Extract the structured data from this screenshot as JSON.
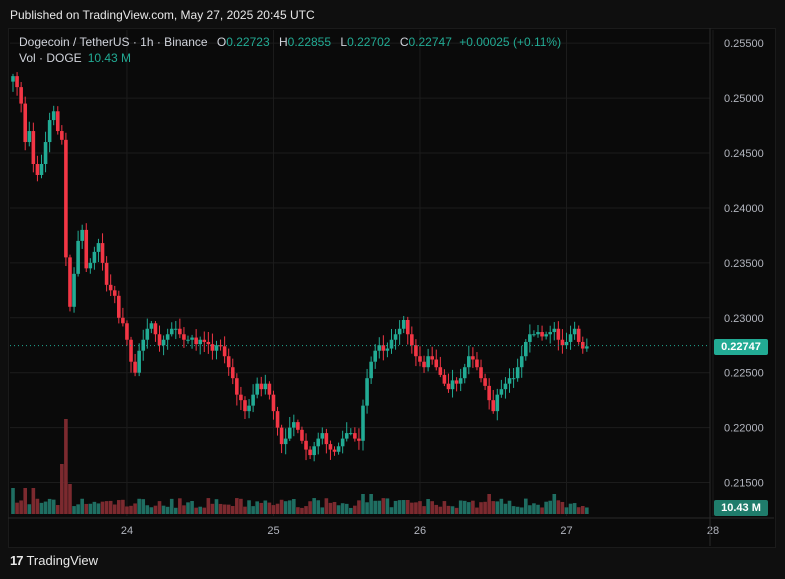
{
  "header": {
    "published": "Published on TradingView.com, May 27, 2025 20:45 UTC"
  },
  "legend": {
    "symbol": "Dogecoin / TetherUS · 1h · Binance",
    "open_label": "O",
    "open": "0.22723",
    "high_label": "H",
    "high": "0.22855",
    "low_label": "L",
    "low": "0.22702",
    "close_label": "C",
    "close": "0.22747",
    "change": "+0.00025 (+0.11%)",
    "vol_label": "Vol · DOGE",
    "vol_value": "10.43 M"
  },
  "price_tag": "0.22747",
  "volume_tag": "10.43 M",
  "footer": {
    "brand": "TradingView",
    "logo_icon": "tradingview-logo-icon"
  },
  "colors": {
    "up": "#22ab94",
    "down": "#f23645",
    "up_volume": "#1f6e62",
    "down_volume": "#7c2a2f",
    "background": "#0a0a0a",
    "grid": "#1c1c1c"
  },
  "chart_data": {
    "type": "candlestick",
    "symbol": "DOGEUSDT",
    "interval": "1h",
    "ylim": [
      0.2125,
      0.2562
    ],
    "y_ticks": [
      "0.25500",
      "0.25000",
      "0.24500",
      "0.24000",
      "0.23500",
      "0.23000",
      "0.22500",
      "0.22000",
      "0.21500"
    ],
    "x_ticks": [
      {
        "label": "24",
        "index": 28
      },
      {
        "label": "25",
        "index": 64
      },
      {
        "label": "26",
        "index": 100
      },
      {
        "label": "27",
        "index": 136
      },
      {
        "label": "28",
        "index": 172
      }
    ],
    "last_price": 0.22747,
    "waypoints_close": [
      [
        0,
        0.252
      ],
      [
        1,
        0.251
      ],
      [
        2,
        0.2495
      ],
      [
        3,
        0.246
      ],
      [
        4,
        0.247
      ],
      [
        5,
        0.244
      ],
      [
        6,
        0.243
      ],
      [
        7,
        0.244
      ],
      [
        8,
        0.246
      ],
      [
        9,
        0.248
      ],
      [
        10,
        0.2488
      ],
      [
        11,
        0.247
      ],
      [
        12,
        0.2462
      ],
      [
        13,
        0.2355
      ],
      [
        14,
        0.231
      ],
      [
        15,
        0.234
      ],
      [
        16,
        0.237
      ],
      [
        17,
        0.238
      ],
      [
        18,
        0.2345
      ],
      [
        19,
        0.235
      ],
      [
        20,
        0.236
      ],
      [
        21,
        0.2368
      ],
      [
        22,
        0.235
      ],
      [
        23,
        0.233
      ],
      [
        24,
        0.2325
      ],
      [
        25,
        0.232
      ],
      [
        26,
        0.23
      ],
      [
        27,
        0.2295
      ],
      [
        28,
        0.228
      ],
      [
        29,
        0.226
      ],
      [
        30,
        0.225
      ],
      [
        31,
        0.227
      ],
      [
        32,
        0.228
      ],
      [
        33,
        0.229
      ],
      [
        34,
        0.2295
      ],
      [
        35,
        0.2285
      ],
      [
        36,
        0.2275
      ],
      [
        37,
        0.228
      ],
      [
        38,
        0.2285
      ],
      [
        39,
        0.229
      ],
      [
        40,
        0.229
      ],
      [
        41,
        0.2285
      ],
      [
        42,
        0.228
      ],
      [
        43,
        0.228
      ],
      [
        44,
        0.2282
      ],
      [
        45,
        0.2276
      ],
      [
        46,
        0.228
      ],
      [
        47,
        0.2278
      ],
      [
        48,
        0.2276
      ],
      [
        49,
        0.227
      ],
      [
        50,
        0.2275
      ],
      [
        51,
        0.2274
      ],
      [
        52,
        0.2265
      ],
      [
        53,
        0.2255
      ],
      [
        54,
        0.2245
      ],
      [
        55,
        0.223
      ],
      [
        56,
        0.2225
      ],
      [
        57,
        0.2215
      ],
      [
        58,
        0.222
      ],
      [
        59,
        0.223
      ],
      [
        60,
        0.224
      ],
      [
        61,
        0.2235
      ],
      [
        62,
        0.224
      ],
      [
        63,
        0.223
      ],
      [
        64,
        0.2215
      ],
      [
        65,
        0.22
      ],
      [
        66,
        0.2185
      ],
      [
        67,
        0.219
      ],
      [
        68,
        0.22
      ],
      [
        69,
        0.2205
      ],
      [
        70,
        0.2198
      ],
      [
        71,
        0.2188
      ],
      [
        72,
        0.218
      ],
      [
        73,
        0.2175
      ],
      [
        74,
        0.2183
      ],
      [
        75,
        0.219
      ],
      [
        76,
        0.2195
      ],
      [
        77,
        0.2185
      ],
      [
        78,
        0.218
      ],
      [
        79,
        0.2178
      ],
      [
        80,
        0.2183
      ],
      [
        81,
        0.219
      ],
      [
        82,
        0.2195
      ],
      [
        83,
        0.2195
      ],
      [
        84,
        0.219
      ],
      [
        85,
        0.2188
      ],
      [
        86,
        0.222
      ],
      [
        87,
        0.2245
      ],
      [
        88,
        0.226
      ],
      [
        89,
        0.227
      ],
      [
        90,
        0.2275
      ],
      [
        91,
        0.227
      ],
      [
        92,
        0.2272
      ],
      [
        93,
        0.228
      ],
      [
        94,
        0.2285
      ],
      [
        95,
        0.229
      ],
      [
        96,
        0.2298
      ],
      [
        97,
        0.2285
      ],
      [
        98,
        0.2275
      ],
      [
        99,
        0.2265
      ],
      [
        100,
        0.226
      ],
      [
        101,
        0.2255
      ],
      [
        102,
        0.2265
      ],
      [
        103,
        0.2262
      ],
      [
        104,
        0.2255
      ],
      [
        105,
        0.2248
      ],
      [
        106,
        0.224
      ],
      [
        107,
        0.2235
      ],
      [
        108,
        0.2243
      ],
      [
        109,
        0.224
      ],
      [
        110,
        0.2245
      ],
      [
        111,
        0.2255
      ],
      [
        112,
        0.2265
      ],
      [
        113,
        0.2262
      ],
      [
        114,
        0.2255
      ],
      [
        115,
        0.2245
      ],
      [
        116,
        0.2238
      ],
      [
        117,
        0.2225
      ],
      [
        118,
        0.2215
      ],
      [
        119,
        0.223
      ],
      [
        120,
        0.2235
      ],
      [
        121,
        0.224
      ],
      [
        122,
        0.2245
      ],
      [
        123,
        0.2245
      ],
      [
        124,
        0.2255
      ],
      [
        125,
        0.2265
      ],
      [
        126,
        0.2278
      ],
      [
        127,
        0.2285
      ],
      [
        128,
        0.2285
      ],
      [
        129,
        0.2287
      ],
      [
        130,
        0.2283
      ],
      [
        131,
        0.2285
      ],
      [
        132,
        0.2287
      ],
      [
        133,
        0.229
      ],
      [
        134,
        0.228
      ],
      [
        135,
        0.2275
      ],
      [
        136,
        0.2278
      ],
      [
        137,
        0.2285
      ],
      [
        138,
        0.229
      ],
      [
        139,
        0.2278
      ],
      [
        140,
        0.2272
      ],
      [
        141,
        0.2274
      ]
    ]
  }
}
